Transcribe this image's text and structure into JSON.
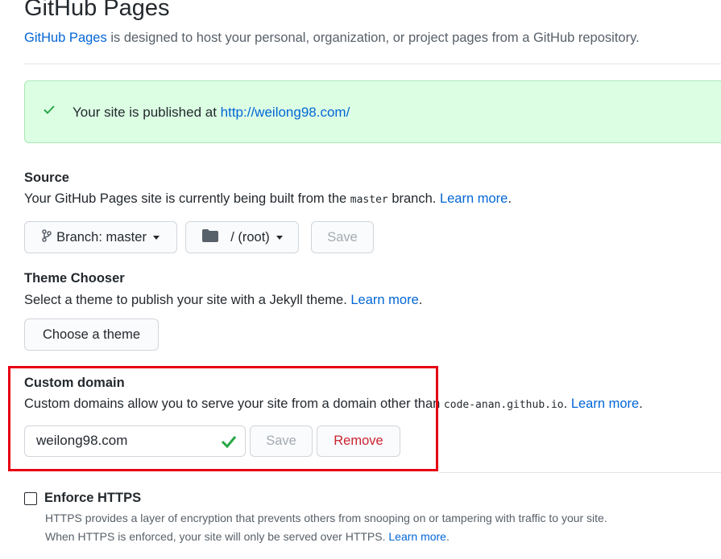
{
  "header": {
    "title": "GitHub Pages",
    "subtitle_link": "GitHub Pages",
    "subtitle_rest": " is designed to host your personal, organization, or project pages from a GitHub repository."
  },
  "flash": {
    "prefix": "Your site is published at ",
    "url": "http://weilong98.com/"
  },
  "source": {
    "title": "Source",
    "desc_before": "Your GitHub Pages site is currently being built from the ",
    "branch_code": "master",
    "desc_after": " branch. ",
    "learn_more": "Learn more",
    "period": ".",
    "branch_button": "Branch: master",
    "folder_button": "/ (root)",
    "save_label": "Save"
  },
  "theme": {
    "title": "Theme Chooser",
    "desc": "Select a theme to publish your site with a Jekyll theme. ",
    "learn_more": "Learn more",
    "period": ".",
    "choose_label": "Choose a theme"
  },
  "custom_domain": {
    "title": "Custom domain",
    "desc_before": "Custom domains allow you to serve your site from a domain other than ",
    "domain_code": "code-anan.github.io",
    "desc_after": ". ",
    "learn_more": "Learn more",
    "period": ".",
    "input_value": "weilong98.com",
    "save_label": "Save",
    "remove_label": "Remove"
  },
  "https": {
    "title": "Enforce HTTPS",
    "line1": "HTTPS provides a layer of encryption that prevents others from snooping on or tampering with traffic to your site.",
    "line2": "When HTTPS is enforced, your site will only be served over HTTPS. ",
    "learn_more": "Learn more",
    "period": "."
  },
  "colors": {
    "link": "#0366d6",
    "success": "#28a745",
    "flash_bg": "#dcffe4",
    "danger": "#cb2431",
    "highlight": "#e60012"
  }
}
